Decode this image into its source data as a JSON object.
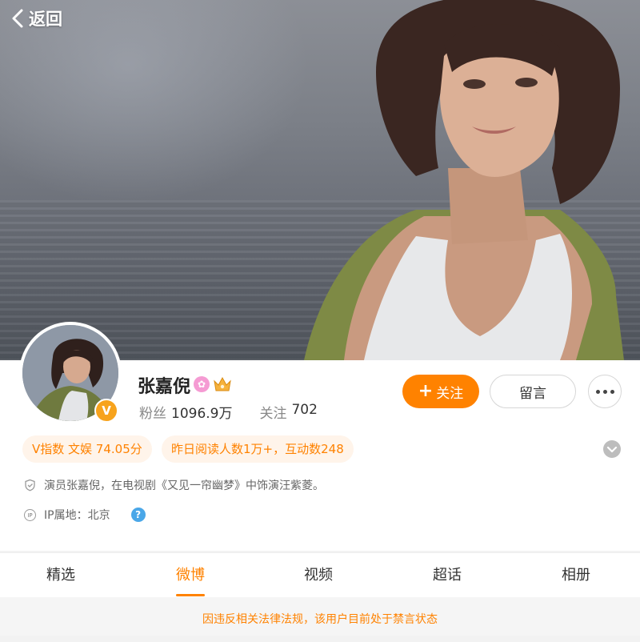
{
  "nav": {
    "back_label": "返回"
  },
  "profile": {
    "name": "张嘉倪",
    "verified_badge": "V",
    "followers_label": "粉丝",
    "followers_value": "1096.9万",
    "following_label": "关注",
    "following_value": "702"
  },
  "actions": {
    "follow_label": "关注",
    "message_label": "留言"
  },
  "tags": [
    {
      "text": "V指数 文娱 74.05分"
    },
    {
      "text": "昨日阅读人数1万+，互动数248"
    }
  ],
  "bio": "演员张嘉倪，在电视剧《又见一帘幽梦》中饰演汪紫菱。",
  "ip": {
    "icon_text": "IP",
    "text": "IP属地：北京",
    "help": "?"
  },
  "tabs": [
    {
      "label": "精选"
    },
    {
      "label": "微博"
    },
    {
      "label": "视频"
    },
    {
      "label": "超话"
    },
    {
      "label": "相册"
    }
  ],
  "notice": "因违反相关法律法规，该用户目前处于禁言状态",
  "colors": {
    "accent": "#ff8200",
    "tag_bg": "#fff4ea",
    "help_blue": "#4aa7e8"
  },
  "icons": [
    "back-chevron-icon",
    "pink-badge-icon",
    "crown-icon",
    "more-dots-icon",
    "expand-chevron-icon",
    "shield-icon",
    "ip-icon",
    "help-icon"
  ]
}
